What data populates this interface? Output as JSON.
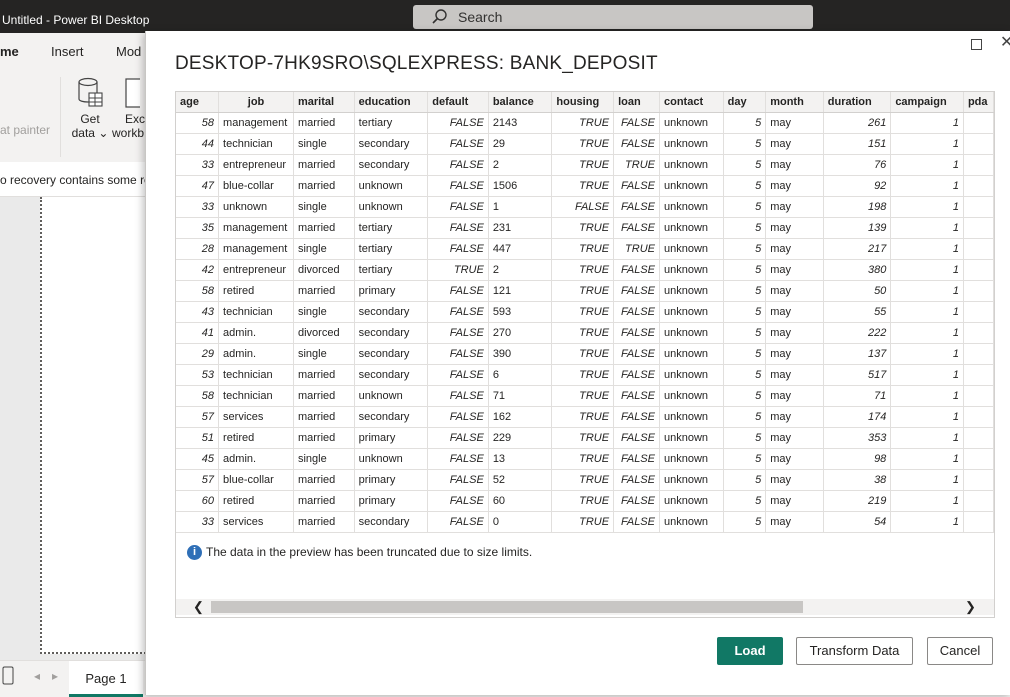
{
  "app": {
    "title": "Untitled - Power BI Desktop",
    "search_placeholder": "Search"
  },
  "ribbon": {
    "tabs": [
      "me",
      "Insert",
      "Mod"
    ],
    "format_painter": "at painter",
    "get_data": "Get",
    "get_data_2": "data",
    "excel": "Exc",
    "excel_2": "workb"
  },
  "notice": "o recovery contains some re",
  "bottom": {
    "page_tab": "Page 1"
  },
  "dialog": {
    "title": "DESKTOP-7HK9SRO\\SQLEXPRESS: BANK_DEPOSIT",
    "info": "The data in the preview has been truncated due to size limits.",
    "buttons": {
      "load": "Load",
      "transform": "Transform Data",
      "cancel": "Cancel"
    }
  },
  "table": {
    "columns": [
      "age",
      "job",
      "marital",
      "education",
      "default",
      "balance",
      "housing",
      "loan",
      "contact",
      "day",
      "month",
      "duration",
      "campaign",
      "pda"
    ],
    "rows": [
      [
        "58",
        "management",
        "married",
        "tertiary",
        "FALSE",
        "2143",
        "TRUE",
        "FALSE",
        "unknown",
        "5",
        "may",
        "261",
        "1"
      ],
      [
        "44",
        "technician",
        "single",
        "secondary",
        "FALSE",
        "29",
        "TRUE",
        "FALSE",
        "unknown",
        "5",
        "may",
        "151",
        "1"
      ],
      [
        "33",
        "entrepreneur",
        "married",
        "secondary",
        "FALSE",
        "2",
        "TRUE",
        "TRUE",
        "unknown",
        "5",
        "may",
        "76",
        "1"
      ],
      [
        "47",
        "blue-collar",
        "married",
        "unknown",
        "FALSE",
        "1506",
        "TRUE",
        "FALSE",
        "unknown",
        "5",
        "may",
        "92",
        "1"
      ],
      [
        "33",
        "unknown",
        "single",
        "unknown",
        "FALSE",
        "1",
        "FALSE",
        "FALSE",
        "unknown",
        "5",
        "may",
        "198",
        "1"
      ],
      [
        "35",
        "management",
        "married",
        "tertiary",
        "FALSE",
        "231",
        "TRUE",
        "FALSE",
        "unknown",
        "5",
        "may",
        "139",
        "1"
      ],
      [
        "28",
        "management",
        "single",
        "tertiary",
        "FALSE",
        "447",
        "TRUE",
        "TRUE",
        "unknown",
        "5",
        "may",
        "217",
        "1"
      ],
      [
        "42",
        "entrepreneur",
        "divorced",
        "tertiary",
        "TRUE",
        "2",
        "TRUE",
        "FALSE",
        "unknown",
        "5",
        "may",
        "380",
        "1"
      ],
      [
        "58",
        "retired",
        "married",
        "primary",
        "FALSE",
        "121",
        "TRUE",
        "FALSE",
        "unknown",
        "5",
        "may",
        "50",
        "1"
      ],
      [
        "43",
        "technician",
        "single",
        "secondary",
        "FALSE",
        "593",
        "TRUE",
        "FALSE",
        "unknown",
        "5",
        "may",
        "55",
        "1"
      ],
      [
        "41",
        "admin.",
        "divorced",
        "secondary",
        "FALSE",
        "270",
        "TRUE",
        "FALSE",
        "unknown",
        "5",
        "may",
        "222",
        "1"
      ],
      [
        "29",
        "admin.",
        "single",
        "secondary",
        "FALSE",
        "390",
        "TRUE",
        "FALSE",
        "unknown",
        "5",
        "may",
        "137",
        "1"
      ],
      [
        "53",
        "technician",
        "married",
        "secondary",
        "FALSE",
        "6",
        "TRUE",
        "FALSE",
        "unknown",
        "5",
        "may",
        "517",
        "1"
      ],
      [
        "58",
        "technician",
        "married",
        "unknown",
        "FALSE",
        "71",
        "TRUE",
        "FALSE",
        "unknown",
        "5",
        "may",
        "71",
        "1"
      ],
      [
        "57",
        "services",
        "married",
        "secondary",
        "FALSE",
        "162",
        "TRUE",
        "FALSE",
        "unknown",
        "5",
        "may",
        "174",
        "1"
      ],
      [
        "51",
        "retired",
        "married",
        "primary",
        "FALSE",
        "229",
        "TRUE",
        "FALSE",
        "unknown",
        "5",
        "may",
        "353",
        "1"
      ],
      [
        "45",
        "admin.",
        "single",
        "unknown",
        "FALSE",
        "13",
        "TRUE",
        "FALSE",
        "unknown",
        "5",
        "may",
        "98",
        "1"
      ],
      [
        "57",
        "blue-collar",
        "married",
        "primary",
        "FALSE",
        "52",
        "TRUE",
        "FALSE",
        "unknown",
        "5",
        "may",
        "38",
        "1"
      ],
      [
        "60",
        "retired",
        "married",
        "primary",
        "FALSE",
        "60",
        "TRUE",
        "FALSE",
        "unknown",
        "5",
        "may",
        "219",
        "1"
      ],
      [
        "33",
        "services",
        "married",
        "secondary",
        "FALSE",
        "0",
        "TRUE",
        "FALSE",
        "unknown",
        "5",
        "may",
        "54",
        "1"
      ]
    ]
  },
  "colors": {
    "accent": "#117865",
    "titlebar": "#252423"
  }
}
